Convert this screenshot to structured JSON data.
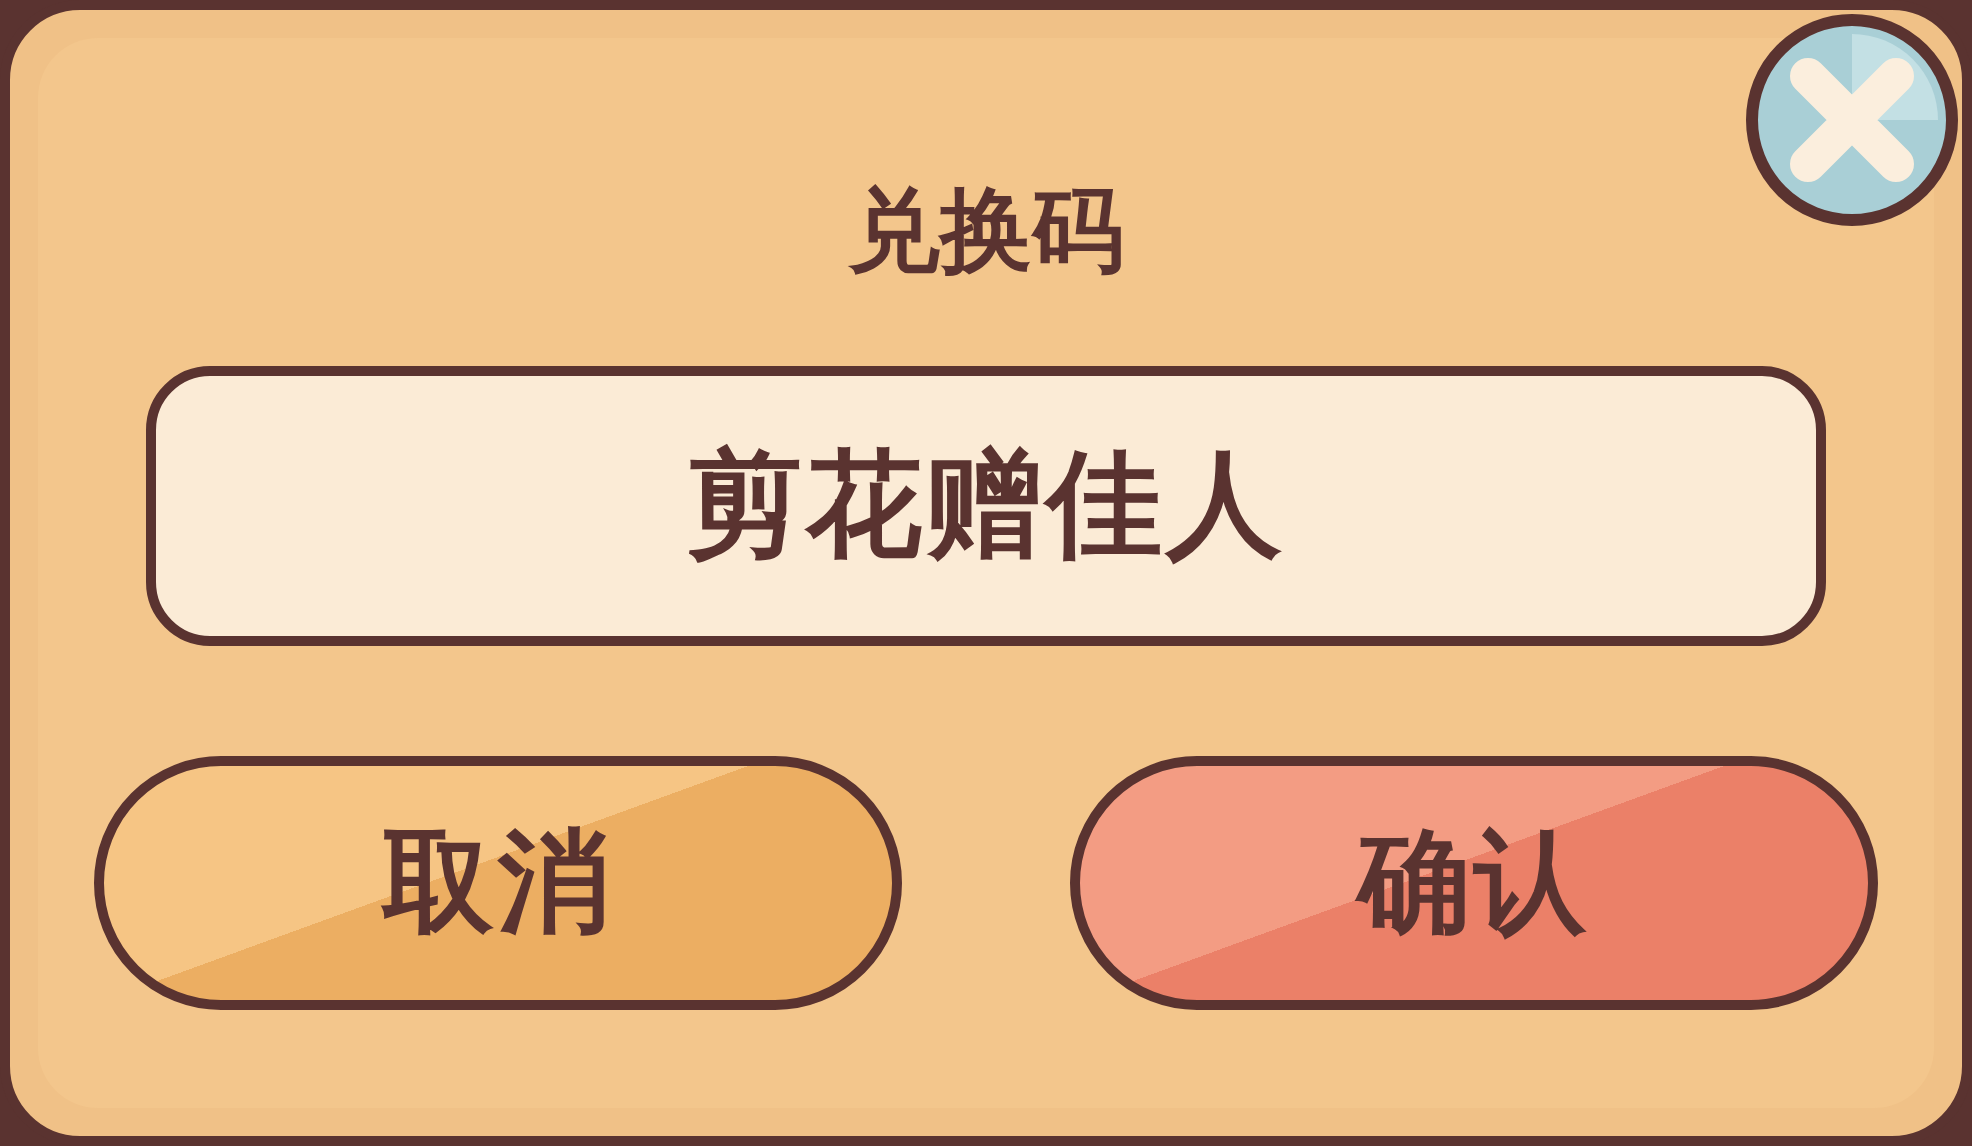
{
  "dialog": {
    "title": "兑换码",
    "code_field": {
      "value": "剪花赠佳人"
    },
    "buttons": [
      {
        "label": "取消",
        "kind": "cancel"
      },
      {
        "label": "确认",
        "kind": "confirm"
      }
    ]
  }
}
